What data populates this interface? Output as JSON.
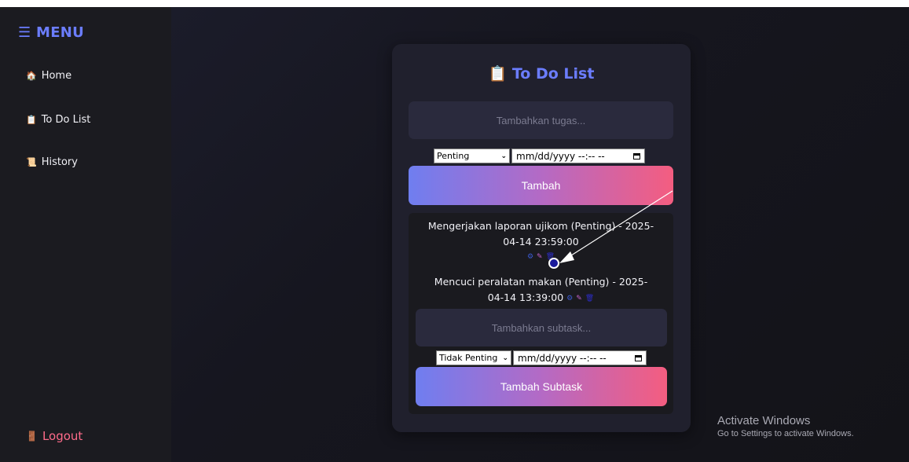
{
  "sidebar": {
    "menu_title": "☰ MENU",
    "items": [
      {
        "icon": "🏠",
        "label": "Home"
      },
      {
        "icon": "📋",
        "label": "To Do List"
      },
      {
        "icon": "📜",
        "label": "History"
      }
    ],
    "logout": {
      "icon": "🚪",
      "label": "Logout"
    }
  },
  "card": {
    "title": "📋 To Do List",
    "task_input_placeholder": "Tambahkan tugas...",
    "priority_select": "Penting",
    "date_placeholder": "mm/dd/yyyy --:-- --",
    "add_button": "Tambah"
  },
  "tasks": [
    {
      "line1": "Mengerjakan laporan ujikom (Penting) - 2025-",
      "line2": "04-14 23:59:00"
    },
    {
      "line1": "Mencuci peralatan makan (Penting) - 2025-",
      "line2": "04-14 13:39:00"
    }
  ],
  "action_icons": {
    "detail": "⚙",
    "edit": "✎",
    "delete": "🗑"
  },
  "subtask": {
    "input_placeholder": "Tambahkan subtask...",
    "priority_select": "Tidak Penting",
    "date_placeholder": "mm/dd/yyyy --:-- --",
    "add_button": "Tambah Subtask"
  },
  "watermark": {
    "title": "Activate Windows",
    "subtitle": "Go to Settings to activate Windows."
  }
}
